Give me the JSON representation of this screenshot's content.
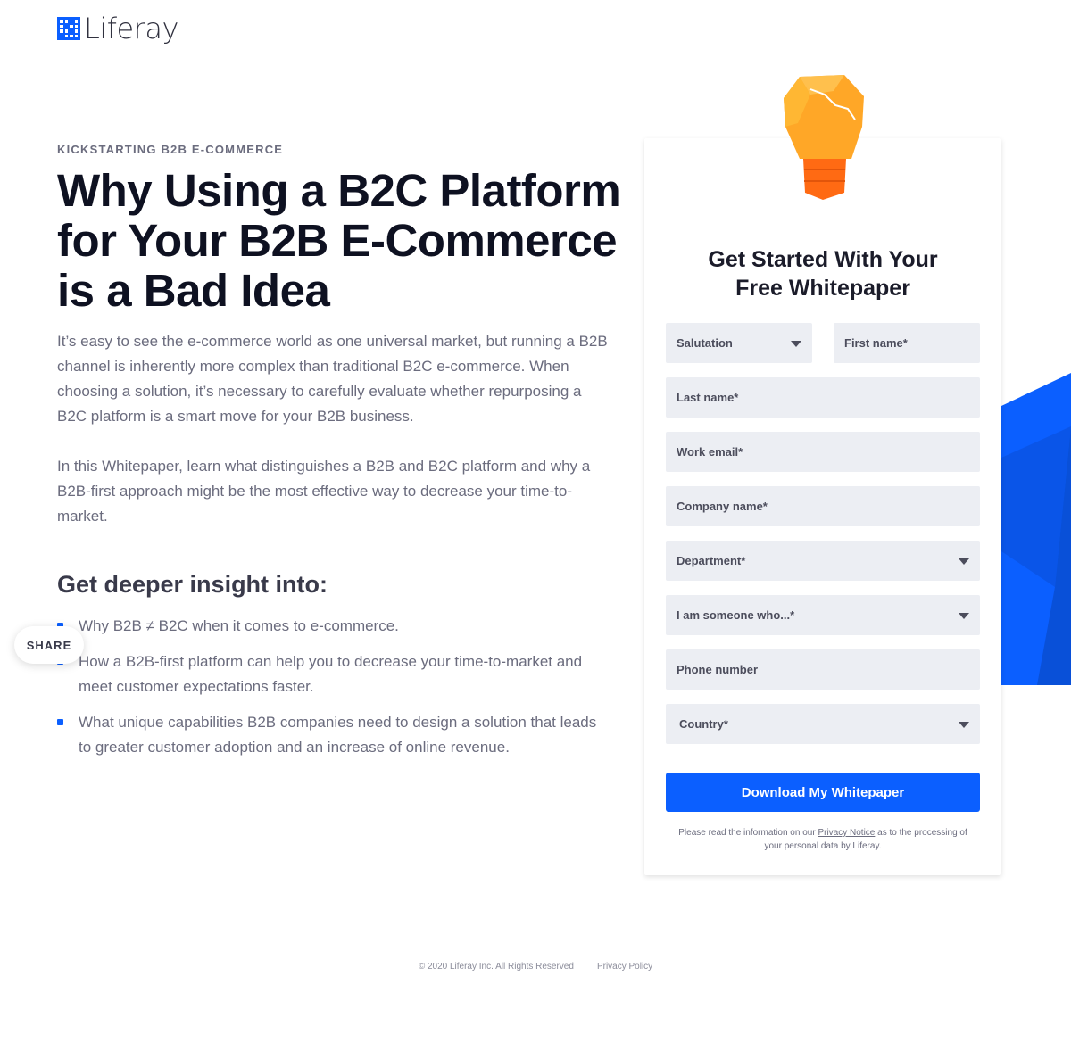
{
  "brand": {
    "name": "Liferay",
    "accent": "#0b5fff"
  },
  "hero": {
    "eyebrow": "KICKSTARTING B2B E-COMMERCE",
    "headline_lines": [
      "Why Using a B2C Platform",
      "for Your B2B E-Commerce",
      "is a Bad Idea"
    ],
    "paragraph_1_lines": [
      "It’s easy to see the e-commerce world as one universal market, but running a B2B",
      "channel is inherently more complex than traditional B2C e-commerce. When",
      "choosing a solution, it’s necessary to carefully evaluate whether repurposing a",
      "B2C platform is a smart move for your B2B business."
    ],
    "paragraph_2_lines": [
      "In this Whitepaper, learn what distinguishes a B2B and B2C platform and why a",
      "B2B-first approach might be the most effective way to decrease your time-to-",
      "market."
    ],
    "subhead": "Get deeper insight into:",
    "bullets": [
      [
        "Why B2B ≠ B2C when it comes to e-commerce."
      ],
      [
        "How a B2B-first platform can help you to decrease your time-to-market and",
        "meet customer expectations faster."
      ],
      [
        "What unique capabilities B2B companies need to design a solution that leads",
        "to greater customer adoption and an increase of online revenue."
      ]
    ]
  },
  "share": {
    "label": "SHARE"
  },
  "form": {
    "title_lines": [
      "Get Started With Your",
      "Free Whitepaper"
    ],
    "fields": {
      "salutation": "Salutation",
      "first_name": "First name*",
      "last_name": "Last name*",
      "work_email": "Work email*",
      "company_name": "Company name*",
      "department": "Department*",
      "role": "I am someone who...*",
      "phone": "Phone number",
      "country": "Country*"
    },
    "submit_label": "Download My Whitepaper",
    "notice_before": "Please read the information on our ",
    "notice_link": "Privacy Notice",
    "notice_after": " as to the processing of",
    "notice_line2": "your personal data by Liferay."
  },
  "footer": {
    "copyright": "© 2020 Liferay Inc. All Rights Reserved",
    "privacy_link": "Privacy Policy"
  }
}
